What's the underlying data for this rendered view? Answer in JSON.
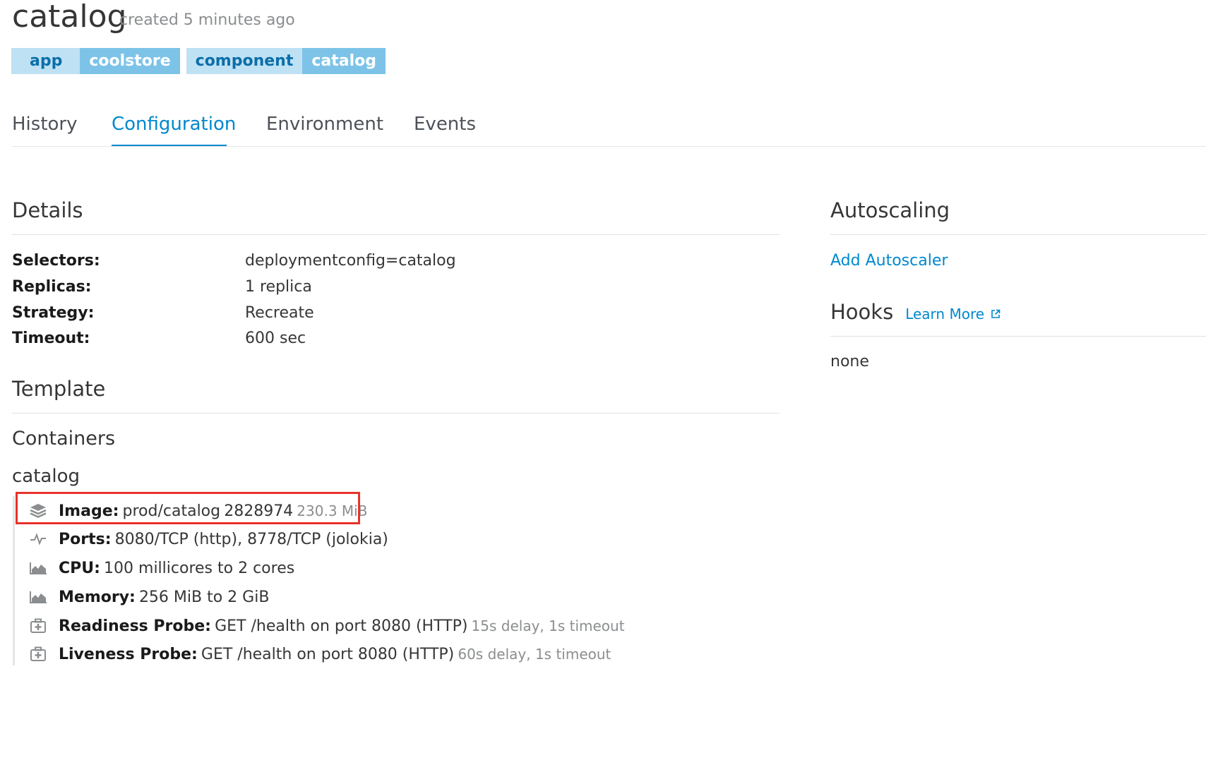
{
  "header": {
    "title": "catalog",
    "subtitle": "created 5 minutes ago"
  },
  "labels": [
    {
      "key": "app",
      "value": "coolstore"
    },
    {
      "key": "component",
      "value": "catalog"
    }
  ],
  "tabs": [
    {
      "label": "History",
      "active": false
    },
    {
      "label": "Configuration",
      "active": true
    },
    {
      "label": "Environment",
      "active": false
    },
    {
      "label": "Events",
      "active": false
    }
  ],
  "details": {
    "heading": "Details",
    "rows": [
      {
        "label": "Selectors:",
        "value": "deploymentconfig=catalog"
      },
      {
        "label": "Replicas:",
        "value": "1 replica"
      },
      {
        "label": "Strategy:",
        "value": "Recreate"
      },
      {
        "label": "Timeout:",
        "value": "600 sec"
      }
    ]
  },
  "template": {
    "heading": "Template",
    "containers_heading": "Containers",
    "container_name": "catalog",
    "image": {
      "label": "Image:",
      "link": "prod/catalog",
      "id": "2828974",
      "size": "230.3 MiB"
    },
    "ports": {
      "label": "Ports:",
      "value": "8080/TCP (http), 8778/TCP (jolokia)"
    },
    "cpu": {
      "label": "CPU:",
      "value": "100 millicores to 2 cores"
    },
    "memory": {
      "label": "Memory:",
      "value": "256 MiB to 2 GiB"
    },
    "readiness": {
      "label": "Readiness Probe:",
      "value": "GET /health on port 8080 (HTTP)",
      "meta": "15s delay, 1s timeout"
    },
    "liveness": {
      "label": "Liveness Probe:",
      "value": "GET /health on port 8080 (HTTP)",
      "meta": "60s delay, 1s timeout"
    }
  },
  "autoscaling": {
    "heading": "Autoscaling",
    "add_link": "Add Autoscaler"
  },
  "hooks": {
    "heading": "Hooks",
    "learn_more": "Learn More",
    "value": "none"
  },
  "colors": {
    "link": "#0088ce",
    "label_key_bg": "#bee1f4",
    "label_value_bg": "#7dc3e8",
    "highlight_border": "#e8322a"
  }
}
